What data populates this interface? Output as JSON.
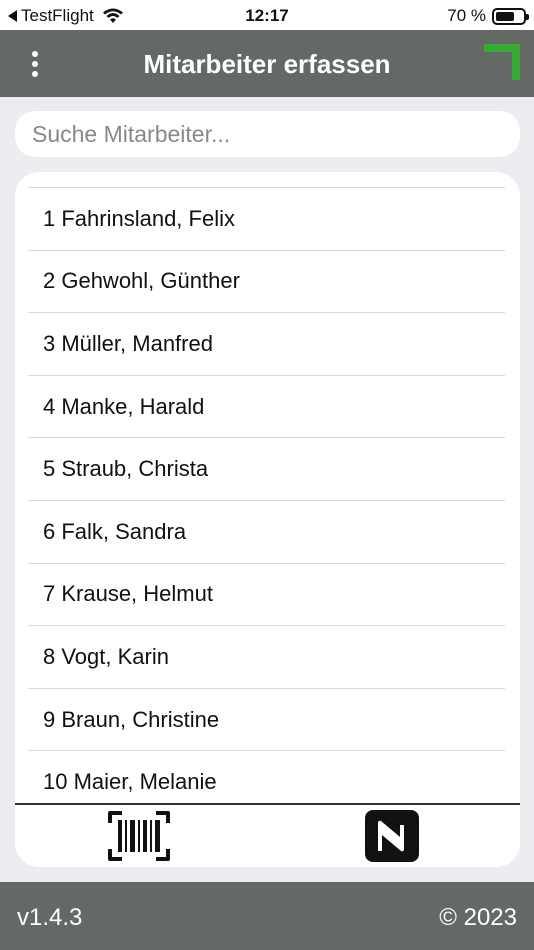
{
  "status_bar": {
    "back_app": "TestFlight",
    "time": "12:17",
    "battery": "70 %",
    "battery_level": 0.7
  },
  "header": {
    "title": "Mitarbeiter erfassen",
    "accent_color": "#39a935"
  },
  "search": {
    "placeholder": "Suche Mitarbeiter...",
    "value": ""
  },
  "employees": [
    "1 Fahrinsland, Felix",
    "2 Gehwohl, Günther",
    "3 Müller, Manfred",
    "4 Manke, Harald",
    "5 Straub, Christa",
    "6 Falk, Sandra",
    "7 Krause, Helmut",
    "8 Vogt, Karin",
    "9 Braun, Christine",
    "10 Maier, Melanie"
  ],
  "actions": {
    "barcode_icon": "barcode-scan-icon",
    "nfc_icon": "nfc-icon"
  },
  "footer": {
    "version": "v1.4.3",
    "copyright": "© 2023"
  }
}
